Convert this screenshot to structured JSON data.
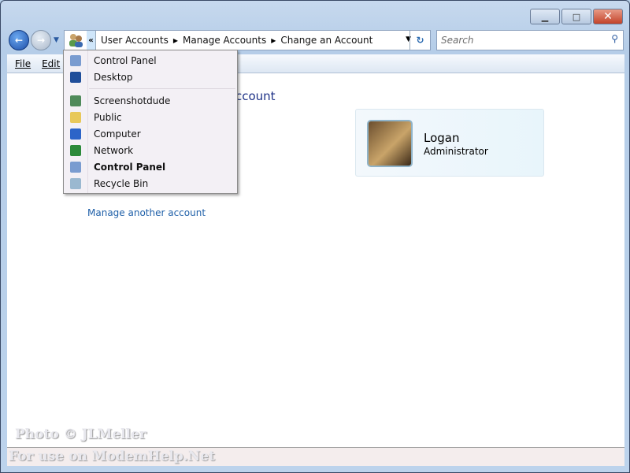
{
  "window": {
    "minimize": "▁",
    "maximize": "□",
    "close": "✕"
  },
  "nav": {
    "back": "←",
    "forward": "→",
    "history": "▼"
  },
  "address": {
    "chevron": "«",
    "crumbs": [
      "User Accounts",
      "Manage Accounts",
      "Change an Account"
    ],
    "separator": "▶",
    "dropdown": "▼",
    "refresh": "↻"
  },
  "search": {
    "placeholder": "Search",
    "icon": "⚲"
  },
  "menu": {
    "file": "File",
    "edit": "Edit"
  },
  "content": {
    "heading_visible": "ccount",
    "manage_link": "Manage another account"
  },
  "account": {
    "name": "Logan",
    "role": "Administrator"
  },
  "popup": {
    "items": [
      {
        "label": "Control Panel",
        "icon": "control-panel",
        "color": "#7a9cd0"
      },
      {
        "label": "Desktop",
        "icon": "desktop",
        "color": "#1f4e9a"
      },
      {
        "label": "Screenshotdude",
        "icon": "user-folder",
        "color": "#4f8a5a"
      },
      {
        "label": "Public",
        "icon": "folder",
        "color": "#e8c85a"
      },
      {
        "label": "Computer",
        "icon": "computer",
        "color": "#2c64c8"
      },
      {
        "label": "Network",
        "icon": "network",
        "color": "#2c8a3a"
      },
      {
        "label": "Control Panel",
        "icon": "control-panel",
        "color": "#7a9cd0",
        "bold": true
      },
      {
        "label": "Recycle Bin",
        "icon": "recycle-bin",
        "color": "#9ab8d0"
      }
    ]
  },
  "watermark": {
    "line1": "Photo © JLMeller",
    "line2": "For use on ModemHelp.Net"
  }
}
